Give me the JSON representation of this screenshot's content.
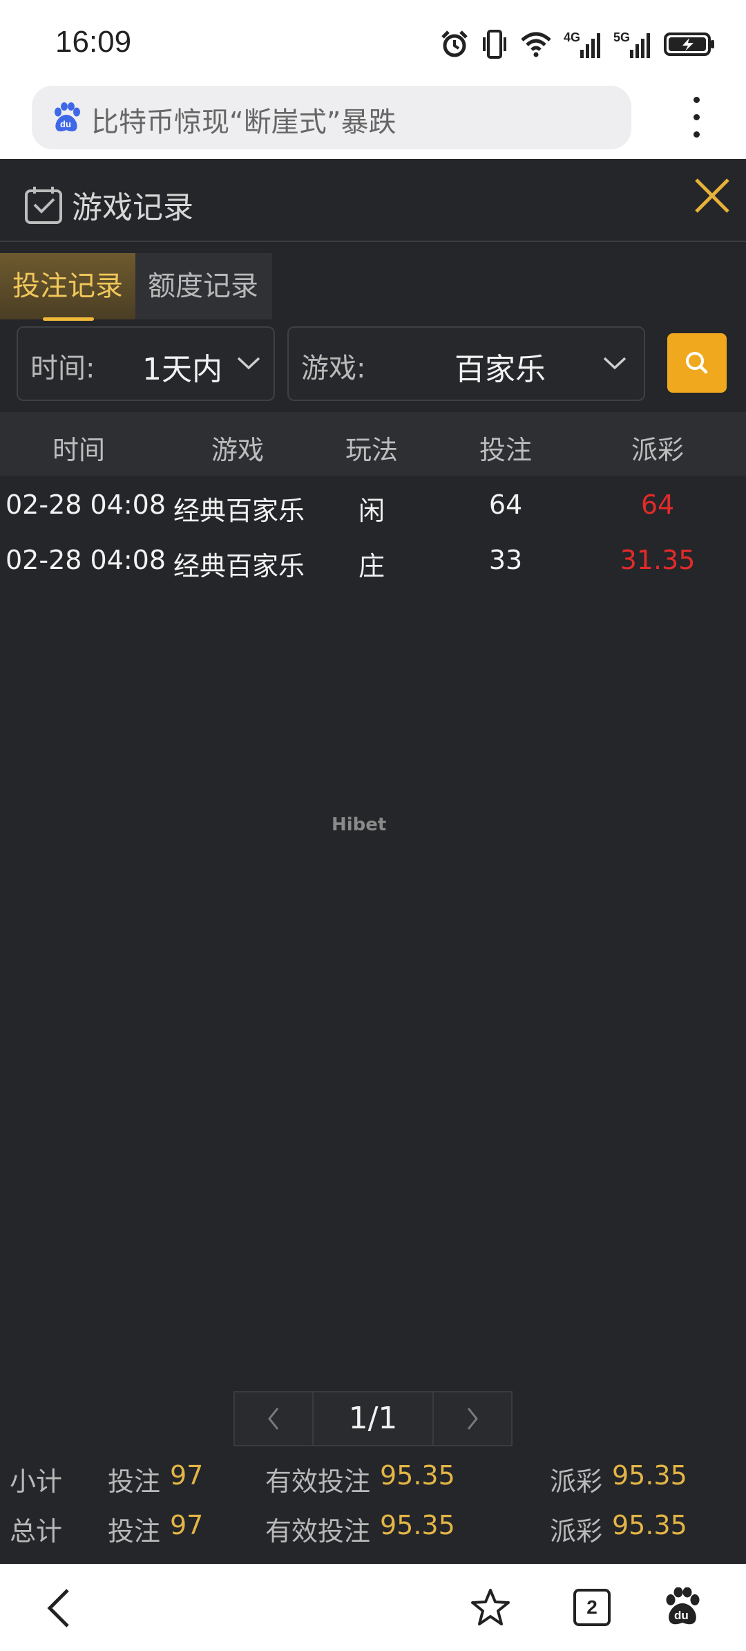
{
  "status_bar": {
    "time": "16:09",
    "icons": [
      "alarm-icon",
      "vibrate-icon",
      "wifi-icon",
      "4g-signal-icon",
      "5g-signal-icon",
      "battery-charging-icon"
    ],
    "net1": "4G",
    "net2": "5G"
  },
  "browser": {
    "url_title": "比特币惊现“断崖式”暴跌",
    "accent_color": "#3f68e8"
  },
  "panel": {
    "title": "游戏记录",
    "tabs": [
      {
        "label": "投注记录",
        "active": true
      },
      {
        "label": "额度记录",
        "active": false
      }
    ],
    "filters": {
      "time_label": "时间:",
      "time_value": "1天内",
      "game_label": "游戏:",
      "game_value": "百家乐"
    },
    "table": {
      "headers": [
        "时间",
        "游戏",
        "玩法",
        "投注",
        "派彩"
      ],
      "rows": [
        {
          "time": "02-28 04:08",
          "game": "经典百家乐",
          "play": "闲",
          "bet": "64",
          "payout": "64"
        },
        {
          "time": "02-28 04:08",
          "game": "经典百家乐",
          "play": "庄",
          "bet": "33",
          "payout": "31.35"
        }
      ]
    },
    "watermark": "Hibet",
    "pagination": {
      "page": "1/1"
    },
    "summary": [
      {
        "label": "小计",
        "bet_label": "投注",
        "bet": "97",
        "valid_label": "有效投注",
        "valid": "95.35",
        "payout_label": "派彩",
        "payout": "95.35"
      },
      {
        "label": "总计",
        "bet_label": "投注",
        "bet": "97",
        "valid_label": "有效投注",
        "valid": "95.35",
        "payout_label": "派彩",
        "payout": "95.35"
      }
    ],
    "colors": {
      "accent": "#f0a91e",
      "gold_text": "#e3b546",
      "payout_red": "#e32a2a",
      "background": "#252629"
    }
  },
  "bottom_nav": {
    "tab_count": "2",
    "icons": [
      "back-icon",
      "star-icon",
      "tabs-icon",
      "baidu-paw-icon"
    ]
  }
}
